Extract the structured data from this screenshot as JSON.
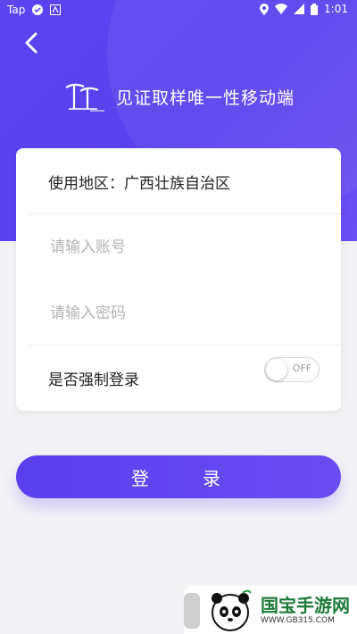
{
  "status_bar": {
    "app_label": "Tap",
    "time": "1:01"
  },
  "header": {
    "title": "见证取样唯一性移动端"
  },
  "form": {
    "area_label": "使用地区",
    "area_colon": "：",
    "area_value": "广西壮族自治区",
    "account_placeholder": "请输入账号",
    "password_placeholder": "请输入密码",
    "force_login_label": "是否强制登录",
    "force_login_state": "OFF"
  },
  "login_button": {
    "label": "登录"
  },
  "watermark": {
    "title": "国宝手游网",
    "url": "WWW.GB315.COM"
  },
  "colors": {
    "accent": "#5b45f0",
    "background": "#f3f3f5"
  }
}
